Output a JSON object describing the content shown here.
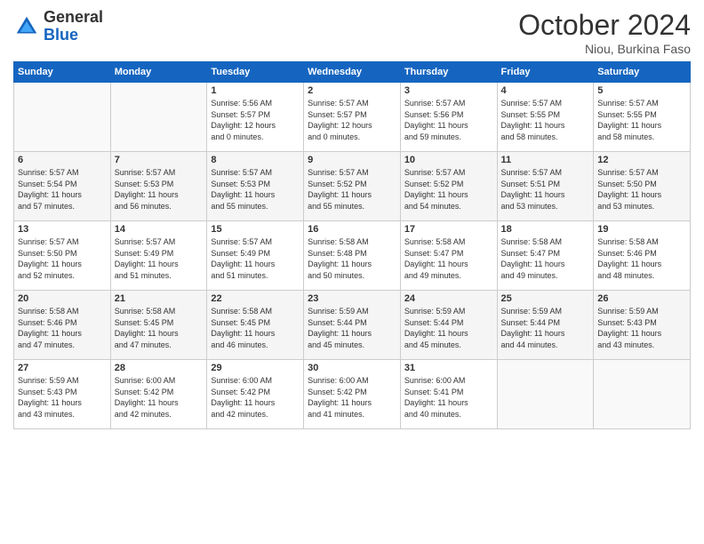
{
  "logo": {
    "general": "General",
    "blue": "Blue"
  },
  "header": {
    "month": "October 2024",
    "location": "Niou, Burkina Faso"
  },
  "days_of_week": [
    "Sunday",
    "Monday",
    "Tuesday",
    "Wednesday",
    "Thursday",
    "Friday",
    "Saturday"
  ],
  "weeks": [
    [
      {
        "day": "",
        "info": ""
      },
      {
        "day": "",
        "info": ""
      },
      {
        "day": "1",
        "info": "Sunrise: 5:56 AM\nSunset: 5:57 PM\nDaylight: 12 hours\nand 0 minutes."
      },
      {
        "day": "2",
        "info": "Sunrise: 5:57 AM\nSunset: 5:57 PM\nDaylight: 12 hours\nand 0 minutes."
      },
      {
        "day": "3",
        "info": "Sunrise: 5:57 AM\nSunset: 5:56 PM\nDaylight: 11 hours\nand 59 minutes."
      },
      {
        "day": "4",
        "info": "Sunrise: 5:57 AM\nSunset: 5:55 PM\nDaylight: 11 hours\nand 58 minutes."
      },
      {
        "day": "5",
        "info": "Sunrise: 5:57 AM\nSunset: 5:55 PM\nDaylight: 11 hours\nand 58 minutes."
      }
    ],
    [
      {
        "day": "6",
        "info": "Sunrise: 5:57 AM\nSunset: 5:54 PM\nDaylight: 11 hours\nand 57 minutes."
      },
      {
        "day": "7",
        "info": "Sunrise: 5:57 AM\nSunset: 5:53 PM\nDaylight: 11 hours\nand 56 minutes."
      },
      {
        "day": "8",
        "info": "Sunrise: 5:57 AM\nSunset: 5:53 PM\nDaylight: 11 hours\nand 55 minutes."
      },
      {
        "day": "9",
        "info": "Sunrise: 5:57 AM\nSunset: 5:52 PM\nDaylight: 11 hours\nand 55 minutes."
      },
      {
        "day": "10",
        "info": "Sunrise: 5:57 AM\nSunset: 5:52 PM\nDaylight: 11 hours\nand 54 minutes."
      },
      {
        "day": "11",
        "info": "Sunrise: 5:57 AM\nSunset: 5:51 PM\nDaylight: 11 hours\nand 53 minutes."
      },
      {
        "day": "12",
        "info": "Sunrise: 5:57 AM\nSunset: 5:50 PM\nDaylight: 11 hours\nand 53 minutes."
      }
    ],
    [
      {
        "day": "13",
        "info": "Sunrise: 5:57 AM\nSunset: 5:50 PM\nDaylight: 11 hours\nand 52 minutes."
      },
      {
        "day": "14",
        "info": "Sunrise: 5:57 AM\nSunset: 5:49 PM\nDaylight: 11 hours\nand 51 minutes."
      },
      {
        "day": "15",
        "info": "Sunrise: 5:57 AM\nSunset: 5:49 PM\nDaylight: 11 hours\nand 51 minutes."
      },
      {
        "day": "16",
        "info": "Sunrise: 5:58 AM\nSunset: 5:48 PM\nDaylight: 11 hours\nand 50 minutes."
      },
      {
        "day": "17",
        "info": "Sunrise: 5:58 AM\nSunset: 5:47 PM\nDaylight: 11 hours\nand 49 minutes."
      },
      {
        "day": "18",
        "info": "Sunrise: 5:58 AM\nSunset: 5:47 PM\nDaylight: 11 hours\nand 49 minutes."
      },
      {
        "day": "19",
        "info": "Sunrise: 5:58 AM\nSunset: 5:46 PM\nDaylight: 11 hours\nand 48 minutes."
      }
    ],
    [
      {
        "day": "20",
        "info": "Sunrise: 5:58 AM\nSunset: 5:46 PM\nDaylight: 11 hours\nand 47 minutes."
      },
      {
        "day": "21",
        "info": "Sunrise: 5:58 AM\nSunset: 5:45 PM\nDaylight: 11 hours\nand 47 minutes."
      },
      {
        "day": "22",
        "info": "Sunrise: 5:58 AM\nSunset: 5:45 PM\nDaylight: 11 hours\nand 46 minutes."
      },
      {
        "day": "23",
        "info": "Sunrise: 5:59 AM\nSunset: 5:44 PM\nDaylight: 11 hours\nand 45 minutes."
      },
      {
        "day": "24",
        "info": "Sunrise: 5:59 AM\nSunset: 5:44 PM\nDaylight: 11 hours\nand 45 minutes."
      },
      {
        "day": "25",
        "info": "Sunrise: 5:59 AM\nSunset: 5:44 PM\nDaylight: 11 hours\nand 44 minutes."
      },
      {
        "day": "26",
        "info": "Sunrise: 5:59 AM\nSunset: 5:43 PM\nDaylight: 11 hours\nand 43 minutes."
      }
    ],
    [
      {
        "day": "27",
        "info": "Sunrise: 5:59 AM\nSunset: 5:43 PM\nDaylight: 11 hours\nand 43 minutes."
      },
      {
        "day": "28",
        "info": "Sunrise: 6:00 AM\nSunset: 5:42 PM\nDaylight: 11 hours\nand 42 minutes."
      },
      {
        "day": "29",
        "info": "Sunrise: 6:00 AM\nSunset: 5:42 PM\nDaylight: 11 hours\nand 42 minutes."
      },
      {
        "day": "30",
        "info": "Sunrise: 6:00 AM\nSunset: 5:42 PM\nDaylight: 11 hours\nand 41 minutes."
      },
      {
        "day": "31",
        "info": "Sunrise: 6:00 AM\nSunset: 5:41 PM\nDaylight: 11 hours\nand 40 minutes."
      },
      {
        "day": "",
        "info": ""
      },
      {
        "day": "",
        "info": ""
      }
    ]
  ]
}
